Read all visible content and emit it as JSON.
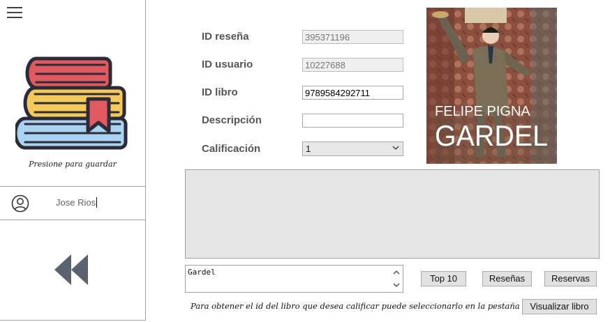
{
  "sidebar": {
    "menu_icon": "hamburger-icon",
    "books_icon": "books-stack-icon",
    "save_hint": "Presione para guardar",
    "user_icon": "user-circle-icon",
    "user_name": "Jose Rios",
    "back_icon": "rewind-icon"
  },
  "form": {
    "review_id_label": "ID reseña",
    "review_id_value": "395371196",
    "user_id_label": "ID usuario",
    "user_id_value": "10227688",
    "book_id_label": "ID libro",
    "book_id_value": "9789584292711",
    "description_label": "Descripción",
    "description_value": "",
    "rating_label": "Calificación",
    "rating_value": "1"
  },
  "cover": {
    "author": "FELIPE PIGNA",
    "title": "GARDEL"
  },
  "search": {
    "value": "Gardel"
  },
  "buttons": {
    "top10": "Top 10",
    "reviews": "Reseñas",
    "reservations": "Reservas",
    "view_book": "Visualizar libro"
  },
  "footer": {
    "hint": "Para obtener el id del libro que desea calificar puede seleccionarlo en la pestaña"
  },
  "colors": {
    "book_red": "#e05a60",
    "book_yellow": "#f5c85a",
    "book_blue": "#a9d3f0",
    "book_outline": "#2b2b3a",
    "icon_gray": "#5a6270"
  }
}
